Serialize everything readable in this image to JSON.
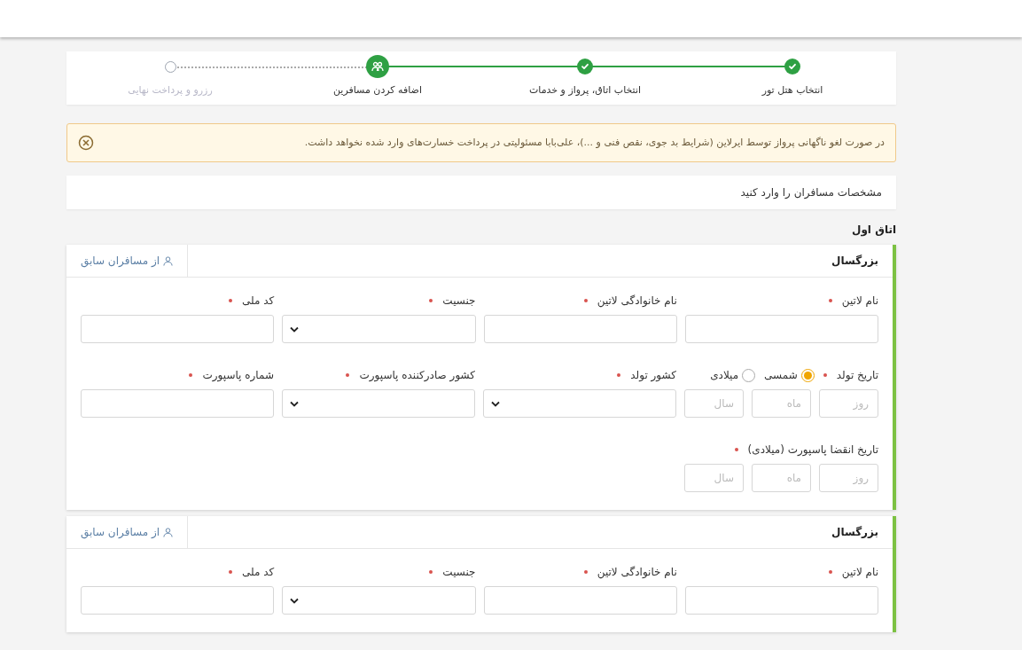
{
  "stepper": [
    {
      "label": "انتخاب هتل تور",
      "completed": true,
      "active": false
    },
    {
      "label": "انتخاب اتاق، پرواز و خدمات",
      "completed": true,
      "active": false
    },
    {
      "label": "اضافه کردن مسافرین",
      "completed": false,
      "active": true
    },
    {
      "label": "رزرو و پرداخت نهایی",
      "completed": false,
      "active": false
    }
  ],
  "alert": {
    "text": "در صورت لغو ناگهانی پرواز توسط ایرلاین (شرایط بد جوی، نقص فنی و ...)، علی‌بابا مسئولیتی در پرداخت خسارت‌های وارد شده نخواهد داشت."
  },
  "instructions": "مشخصات مسافران را وارد کنید",
  "room": {
    "title": "اتاق اول",
    "passengers": [
      {
        "type": "بزرگسال",
        "previous_link": "از مسافران سابق",
        "rows": [
          [
            {
              "kind": "text",
              "label": "نام لاتین",
              "required": true
            },
            {
              "kind": "text",
              "label": "نام خانوادگی لاتین",
              "required": true
            },
            {
              "kind": "select",
              "label": "جنسیت",
              "required": true
            },
            {
              "kind": "text",
              "label": "کد ملی",
              "required": true
            }
          ],
          [
            {
              "kind": "date",
              "label": "تاریخ تولد",
              "required": true,
              "options": [
                {
                  "label": "شمسی",
                  "selected": true
                },
                {
                  "label": "میلادی",
                  "selected": false
                }
              ],
              "parts": [
                {
                  "placeholder": "روز"
                },
                {
                  "placeholder": "ماه"
                },
                {
                  "placeholder": "سال"
                }
              ]
            },
            {
              "kind": "select",
              "label": "کشور تولد",
              "required": true
            },
            {
              "kind": "select",
              "label": "کشور صادرکننده پاسپورت",
              "required": true
            },
            {
              "kind": "text",
              "label": "شماره پاسپورت",
              "required": true
            }
          ],
          [
            {
              "kind": "date",
              "label": "تاریخ انقضا پاسپورت (میلادی)",
              "required": true,
              "parts": [
                {
                  "placeholder": "روز"
                },
                {
                  "placeholder": "ماه"
                },
                {
                  "placeholder": "سال"
                }
              ]
            }
          ]
        ]
      },
      {
        "type": "بزرگسال",
        "previous_link": "از مسافران سابق",
        "rows": [
          [
            {
              "kind": "text",
              "label": "نام لاتین",
              "required": true
            },
            {
              "kind": "text",
              "label": "نام خانوادگی لاتین",
              "required": true
            },
            {
              "kind": "select",
              "label": "جنسیت",
              "required": true
            },
            {
              "kind": "text",
              "label": "کد ملی",
              "required": true
            }
          ]
        ]
      }
    ]
  }
}
